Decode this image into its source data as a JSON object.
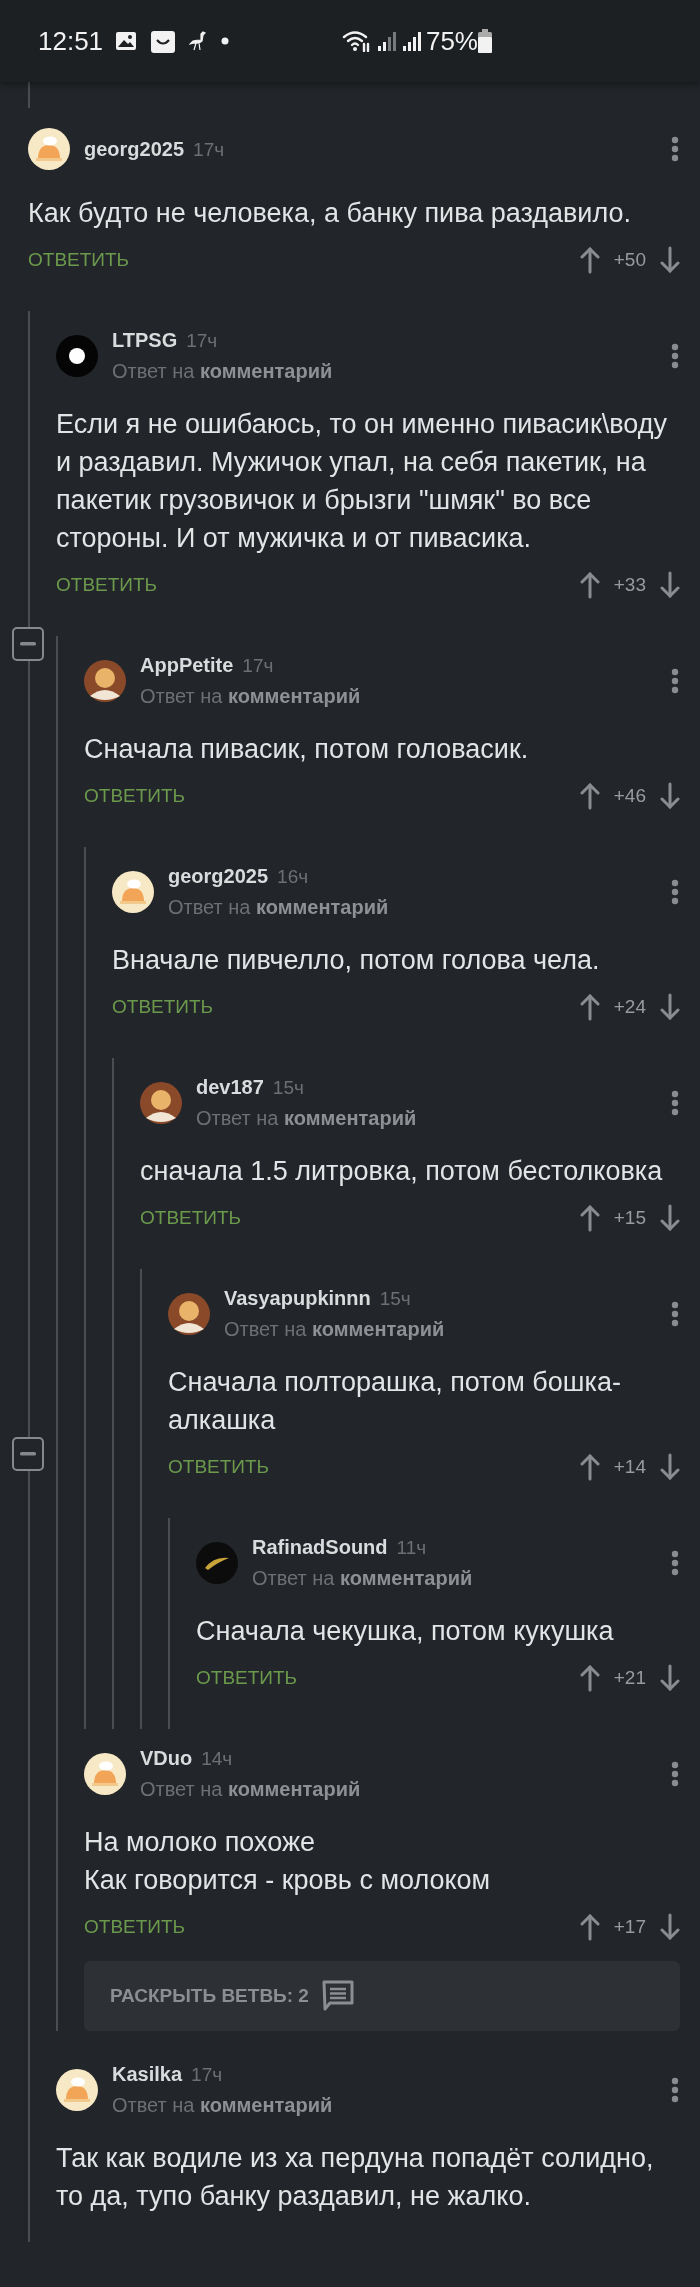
{
  "status_bar": {
    "time": "12:51",
    "battery": "75%"
  },
  "comments": [
    {
      "author": "georg2025",
      "time": "17ч",
      "avatar": {
        "kind": "default"
      },
      "body": [
        "Как будто не человека, а банку пива раздавило."
      ],
      "reply": "ОТВЕТИТЬ",
      "score": "+50",
      "children": [
        {
          "author": "LTPSG",
          "time": "17ч",
          "reply_note": "Ответ на **комментарий**",
          "avatar": {
            "kind": "dot"
          },
          "body": [
            "Если я не ошибаюсь, то он именно пивасик\\воду и раздавил. Мужичок упал, на себя пакетик, на пакетик грузовичок и брызги \"шмяк\" во все стороны. И от мужичка и от пивасика."
          ],
          "reply": "ОТВЕТИТЬ",
          "score": "+33",
          "children": [
            {
              "author": "AppPetite",
              "time": "17ч",
              "reply_note": "Ответ на **комментарий**",
              "avatar": {
                "kind": "picture"
              },
              "toggle_at_header": true,
              "body": [
                "Сначала пивасик, потом головасик."
              ],
              "reply": "ОТВЕТИТЬ",
              "score": "+46",
              "children": [
                {
                  "author": "georg2025",
                  "time": "16ч",
                  "reply_note": "Ответ на **комментарий**",
                  "avatar": {
                    "kind": "default"
                  },
                  "body": [
                    "Вначале пивчелло, потом голова чела."
                  ],
                  "reply": "ОТВЕТИТЬ",
                  "score": "+24",
                  "children": [
                    {
                      "author": "dev187",
                      "time": "15ч",
                      "reply_note": "Ответ на **комментарий**",
                      "avatar": {
                        "kind": "picture"
                      },
                      "body": [
                        "сначала 1.5 литровка, потом бестолковка"
                      ],
                      "reply": "ОТВЕТИТЬ",
                      "score": "+15",
                      "children": [
                        {
                          "author": "Vasyapupkinnn",
                          "time": "15ч",
                          "reply_note": "Ответ на **комментарий**",
                          "avatar": {
                            "kind": "picture"
                          },
                          "toggle_at_actions": true,
                          "body": [
                            "Сначала полторашка, потом бошка-алкашка"
                          ],
                          "reply": "ОТВЕТИТЬ",
                          "score": "+14",
                          "children": [
                            {
                              "author": "RafinadSound",
                              "time": "11ч",
                              "reply_note": "Ответ на **комментарий**",
                              "avatar": {
                                "kind": "dark"
                              },
                              "body": [
                                "Сначала чекушка, потом кукушка"
                              ],
                              "reply": "ОТВЕТИТЬ",
                              "score": "+21"
                            }
                          ]
                        }
                      ]
                    }
                  ]
                }
              ]
            },
            {
              "author": "VDuo",
              "time": "14ч",
              "reply_note": "Ответ на **комментарий**",
              "avatar": {
                "kind": "default"
              },
              "body": [
                "На молоко похоже",
                "Как говорится - кровь с молоком"
              ],
              "reply": "ОТВЕТИТЬ",
              "score": "+17",
              "expand": {
                "label": "РАСКРЫТЬ ВЕТВЬ: 2"
              }
            }
          ]
        },
        {
          "author": "Kasilka",
          "time": "17ч",
          "reply_note": "Ответ на **комментарий**",
          "avatar": {
            "kind": "default"
          },
          "body": [
            "Так как водиле из ха пердуна попадёт солидно, то да, тупо банку раздавил, не жалко."
          ]
        }
      ]
    }
  ]
}
